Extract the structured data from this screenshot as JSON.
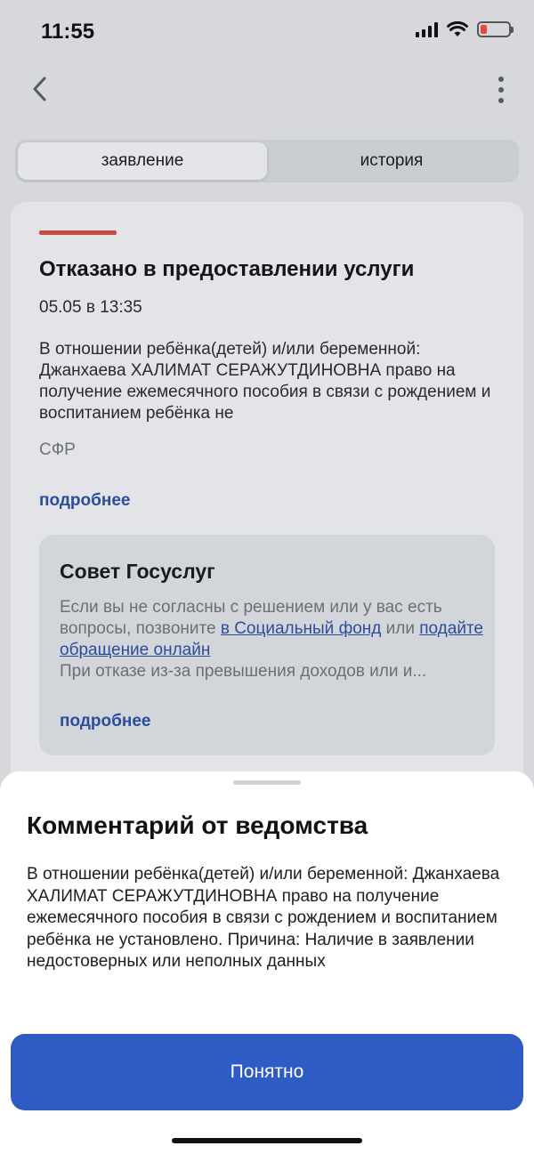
{
  "status_bar": {
    "time": "11:55",
    "icons": [
      "signal-icon",
      "wifi-icon",
      "battery-icon"
    ],
    "battery_color": "#e5483d"
  },
  "nav": {
    "back_icon": "chevron-left-icon",
    "more_icon": "more-vertical-icon"
  },
  "tabs": [
    {
      "label": "заявление",
      "active": true
    },
    {
      "label": "история",
      "active": false
    }
  ],
  "card": {
    "accent_color": "#c94a44",
    "title": "Отказано в предоставлении услуги",
    "date": "05.05 в 13:35",
    "text": "В отношении ребёнка(детей) и/или беременной: Джанхаева ХАЛИМАТ СЕРАЖУТДИНОВНА право на получение ежемесячного пособия в связи с рождением и воспитанием ребёнка не",
    "org": "СФР",
    "more_label": "подробнее"
  },
  "tip": {
    "title": "Совет Госуслуг",
    "text_part1": "Если вы не согласны с решением или у вас есть вопросы, позвоните ",
    "link1": "в Социальный фонд",
    "text_part2": " или ",
    "link2": "подайте обращение онлайн",
    "text_part3": "При отказе из-за превышения доходов или и...",
    "more_label": "подробнее"
  },
  "sheet": {
    "title": "Комментарий от ведомства",
    "text": "В отношении ребёнка(детей) и/или беременной: Джанхаева ХАЛИМАТ СЕРАЖУТДИНОВНА право на получение ежемесячного пособия в связи с рождением и воспитанием ребёнка не установлено. Причина: Наличие в заявлении недостоверных или неполных данных",
    "button_label": "Понятно",
    "button_color": "#2e5bc4"
  }
}
